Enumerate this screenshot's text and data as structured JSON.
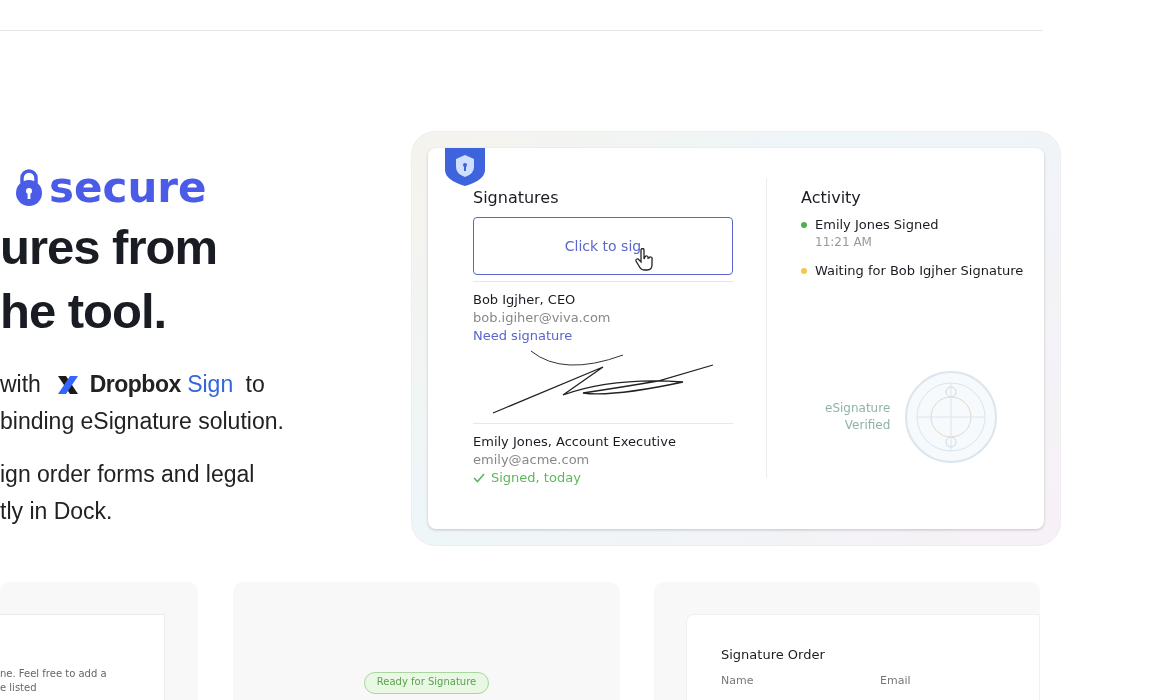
{
  "hero": {
    "tagline": "secure",
    "heading_lines": [
      "ures from",
      "he tool."
    ],
    "intro": {
      "before": "with",
      "brand": "Dropbox",
      "product": "Sign",
      "after": "to",
      "line2": "binding eSignature solution."
    },
    "paragraph_lines": [
      "ign order forms and legal",
      "tly in Dock."
    ]
  },
  "card": {
    "signatures_title": "Signatures",
    "sign_field": "Click to sig",
    "signers": [
      {
        "name": "Bob Igjher, CEO",
        "email": "bob.igiher@viva.com",
        "status": "Need signature",
        "kind": "pending"
      },
      {
        "name": "Emily Jones, Account Executive",
        "email": "emily@acme.com",
        "status": "Signed, today",
        "kind": "signed"
      }
    ],
    "activity_title": "Activity",
    "activity": [
      {
        "text": "Emily Jones Signed",
        "time": "11:21 AM",
        "color": "#4caf50"
      },
      {
        "text": "Waiting for Bob Igjher Signature",
        "color": "#f2c94c"
      }
    ],
    "seal_lines": [
      "eSignature",
      "Verified"
    ]
  },
  "bottom": {
    "note_lines": [
      "ne. Feel free to add a",
      "e listed"
    ],
    "badge": "Ready for Signature",
    "order_title": "Signature Order",
    "order_columns": [
      "Name",
      "Email"
    ]
  }
}
